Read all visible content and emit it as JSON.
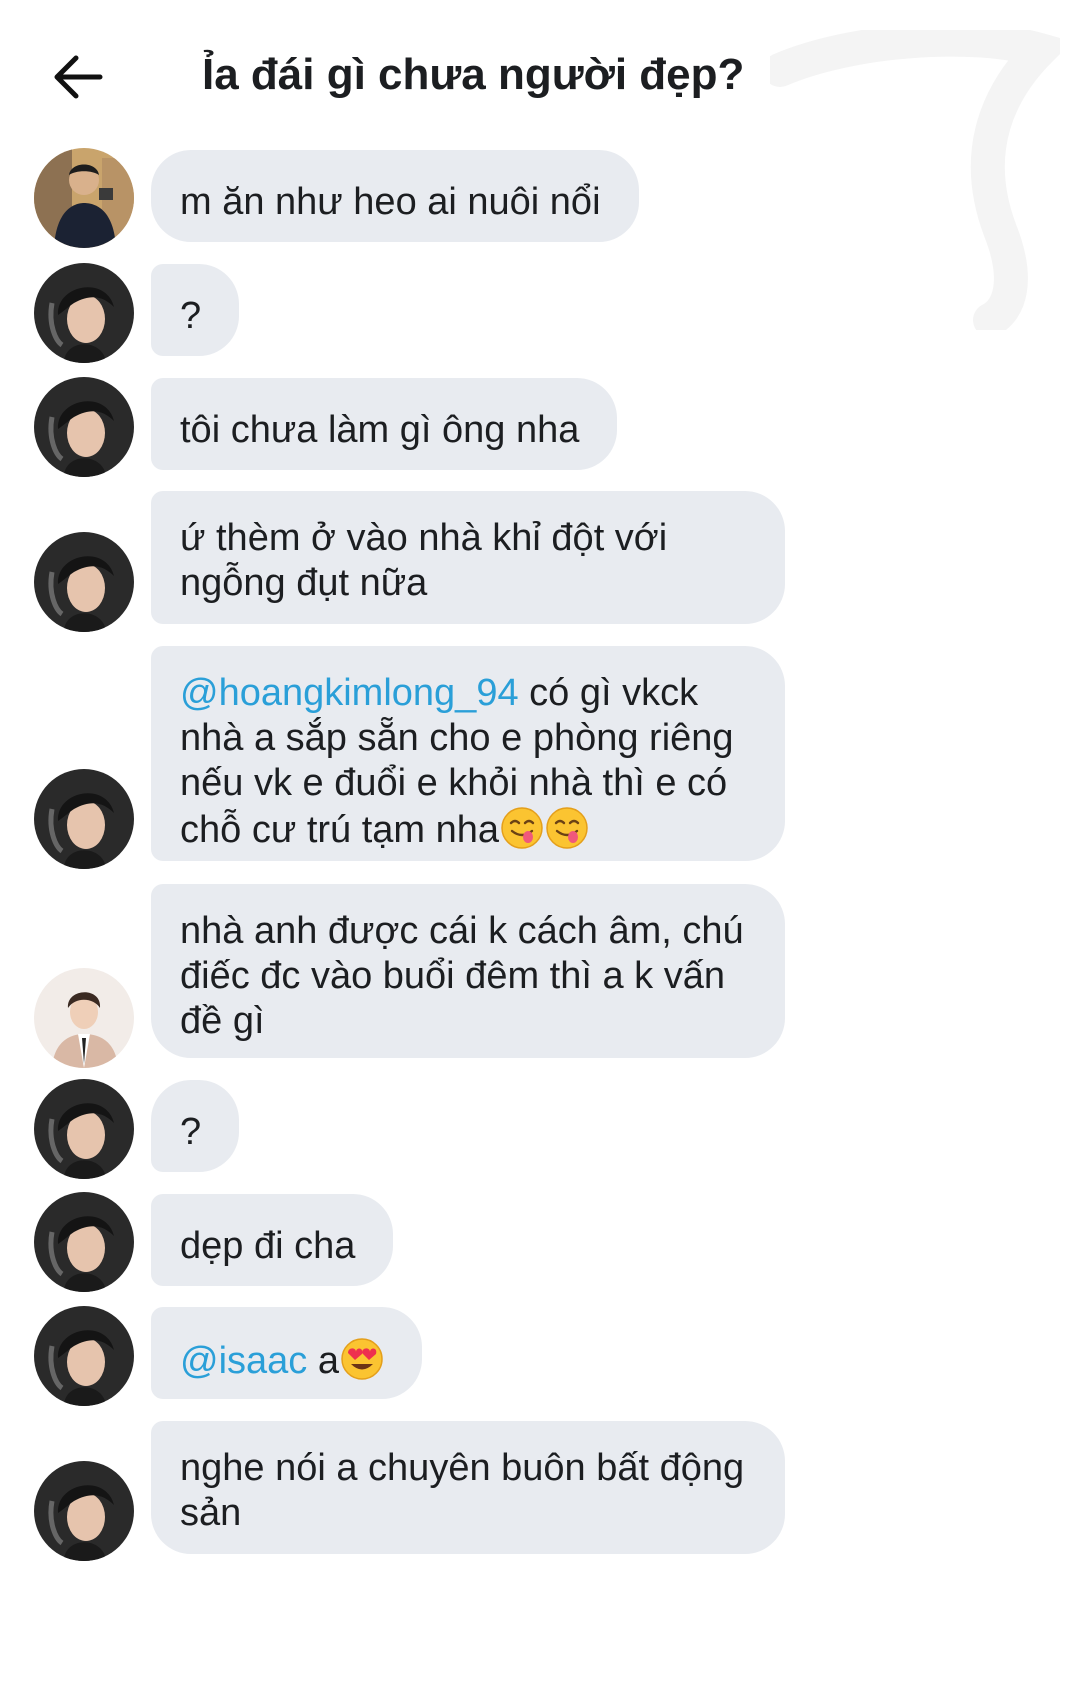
{
  "header": {
    "back_icon": "arrow-left-icon",
    "title": "Ỉa đái gì chưa người đẹp?"
  },
  "messages": [
    {
      "avatar": "avatar-user-1",
      "text": "m ăn như heo ai nuôi nổi"
    },
    {
      "avatar": "avatar-user-2",
      "text": "?"
    },
    {
      "avatar": "avatar-user-2",
      "text": "tôi chưa làm gì ông nha"
    },
    {
      "avatar": "avatar-user-2",
      "text": "ứ thèm ở vào nhà khỉ đột với ngỗng đụt nữa"
    },
    {
      "avatar": "avatar-user-2",
      "mention": "@hoangkimlong_94",
      "text": " có gì vkck nhà a sắp sẵn cho e phòng riêng nếu vk e đuổi e khỏi nhà thì e có chỗ cư trú tạm nha",
      "emojis": [
        "savoring-face-emoji",
        "savoring-face-emoji"
      ]
    },
    {
      "avatar": "avatar-user-3",
      "text": "nhà anh được cái k cách âm, chú điếc đc vào buổi đêm thì a k vấn đề gì"
    },
    {
      "avatar": "avatar-user-2",
      "text": "?"
    },
    {
      "avatar": "avatar-user-2",
      "text": "dẹp đi cha"
    },
    {
      "avatar": "avatar-user-2",
      "mention": "@isaac",
      "text": " a",
      "emojis": [
        "heart-eyes-emoji"
      ]
    },
    {
      "avatar": "avatar-user-2",
      "text": "nghe nói a chuyên buôn bất động sản"
    }
  ],
  "colors": {
    "bubble": "#e8ebf0",
    "mention": "#2a9fd8",
    "text": "#1c1e21"
  }
}
